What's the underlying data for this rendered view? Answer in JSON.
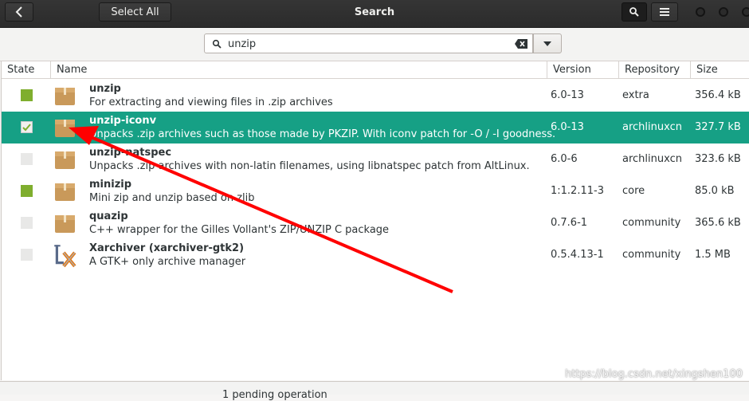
{
  "header": {
    "back_label": "<",
    "select_all_label": "Select All",
    "title": "Search"
  },
  "search": {
    "value": "unzip",
    "placeholder": ""
  },
  "table": {
    "columns": {
      "state": "State",
      "name": "Name",
      "version": "Version",
      "repository": "Repository",
      "size": "Size"
    },
    "rows": [
      {
        "name": "unzip",
        "description": "For extracting and viewing files in .zip archives",
        "version": "6.0-13",
        "repository": "extra",
        "size": "356.4 kB",
        "state": "installed",
        "icon": "package-icon"
      },
      {
        "name": "unzip-iconv",
        "description": "Unpacks .zip archives such as those made by PKZIP. With iconv patch for -O / -I goodness.",
        "version": "6.0-13",
        "repository": "archlinuxcn",
        "size": "327.7 kB",
        "state": "to-install",
        "icon": "package-icon"
      },
      {
        "name": "unzip-natspec",
        "description": "Unpacks .zip archives with non-latin filenames, using libnatspec patch from AltLinux.",
        "version": "6.0-6",
        "repository": "archlinuxcn",
        "size": "323.6 kB",
        "state": "available",
        "icon": "package-icon"
      },
      {
        "name": "minizip",
        "description": "Mini zip and unzip based on zlib",
        "version": "1:1.2.11-3",
        "repository": "core",
        "size": "85.0 kB",
        "state": "installed",
        "icon": "package-icon"
      },
      {
        "name": "quazip",
        "description": "C++ wrapper for the Gilles Vollant's ZIP/UNZIP C package",
        "version": "0.7.6-1",
        "repository": "community",
        "size": "365.6 kB",
        "state": "available",
        "icon": "package-icon"
      },
      {
        "name": "Xarchiver  (xarchiver-gtk2)",
        "description": "A GTK+ only archive manager",
        "version": "0.5.4.13-1",
        "repository": "community",
        "size": "1.5 MB",
        "state": "available",
        "icon": "xarchiver-icon"
      }
    ]
  },
  "status": {
    "text": "1 pending operation"
  },
  "watermark": "https://blog.csdn.net/xingshen100",
  "colors": {
    "installed": "#7fae2e",
    "selected_row": "#16a085",
    "available": "#e8e8e7",
    "arrow": "#ff0000"
  }
}
